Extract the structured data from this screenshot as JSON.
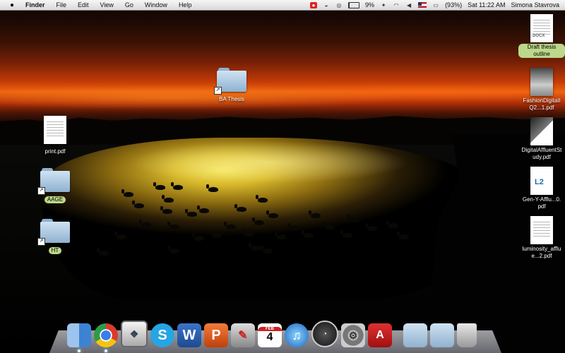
{
  "menubar": {
    "apple_icon": "apple-logo-icon",
    "items": [
      "Finder",
      "File",
      "Edit",
      "View",
      "Go",
      "Window",
      "Help"
    ],
    "battery_level": "9%",
    "battery_fraction": 0.09,
    "volume_icon": "speaker-icon",
    "battery_percent": "(93%)",
    "clock": "Sat 11:22 AM",
    "user": "Simona Stavrova"
  },
  "desktop": {
    "left_icons": [
      {
        "label": "print.pdf",
        "kind": "document"
      },
      {
        "label": "AAGE",
        "kind": "folder-alias"
      },
      {
        "label": "HT",
        "kind": "folder-alias"
      }
    ],
    "center_icon": {
      "label": "BA Thesis",
      "kind": "folder-alias"
    },
    "right_icons": [
      {
        "label": "Draft thesis outline",
        "kind": "document",
        "tag": "DOCX"
      },
      {
        "label": "FashionDigitalIQ2...1.pdf",
        "kind": "document"
      },
      {
        "label": "DigitalAffluentStudy.pdf",
        "kind": "document"
      },
      {
        "label": "Gen-Y-Afflu...0.pdf",
        "kind": "document",
        "tag": "L2"
      },
      {
        "label": "luminosity_afflue...2.pdf",
        "kind": "document"
      }
    ]
  },
  "dock": {
    "apps": [
      {
        "name": "Finder",
        "icon": "finder-icon",
        "glyph": "",
        "running": true
      },
      {
        "name": "Chrome",
        "icon": "chrome-icon",
        "glyph": "",
        "running": true
      },
      {
        "name": "Preview",
        "icon": "preview-icon",
        "glyph": "❖",
        "running": false
      },
      {
        "name": "Skype",
        "icon": "skype-icon",
        "glyph": "S",
        "running": false
      },
      {
        "name": "Word",
        "icon": "word-icon",
        "glyph": "W",
        "running": false
      },
      {
        "name": "PowerPoint",
        "icon": "powerpoint-icon",
        "glyph": "P",
        "running": false
      },
      {
        "name": "Script Editor",
        "icon": "script-editor-icon",
        "glyph": "✎",
        "running": false
      },
      {
        "name": "Calendar",
        "icon": "calendar-icon",
        "glyph": "4",
        "month": "FEB",
        "running": false
      },
      {
        "name": "iTunes",
        "icon": "itunes-icon",
        "glyph": "♫",
        "running": false
      },
      {
        "name": "Dashboard",
        "icon": "dashboard-icon",
        "glyph": "◔",
        "running": false
      },
      {
        "name": "System Preferences",
        "icon": "system-preferences-icon",
        "glyph": "⚙",
        "running": false
      },
      {
        "name": "Acrobat",
        "icon": "acrobat-icon",
        "glyph": "A",
        "running": false
      }
    ],
    "folders": [
      {
        "name": "Applications",
        "icon": "applications-folder-icon"
      },
      {
        "name": "Documents",
        "icon": "documents-folder-icon"
      }
    ],
    "trash": {
      "name": "Trash",
      "icon": "trash-icon"
    }
  }
}
